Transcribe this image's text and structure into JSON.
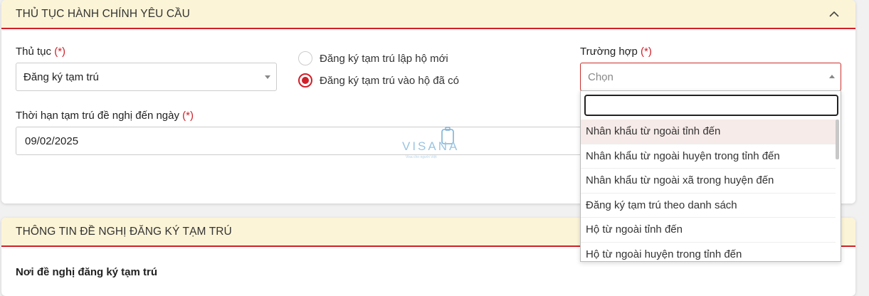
{
  "section1": {
    "title": "THỦ TỤC HÀNH CHÍNH YÊU CẦU"
  },
  "procedure": {
    "label": "Thủ tục",
    "required": "(*)",
    "value": "Đăng ký tạm trú"
  },
  "options": [
    {
      "label": "Đăng ký tạm trú lập hộ mới",
      "checked": false
    },
    {
      "label": "Đăng ký tạm trú vào hộ đã có",
      "checked": true
    }
  ],
  "case_field": {
    "label": "Trường hợp",
    "required": "(*)",
    "placeholder": "Chọn"
  },
  "duration": {
    "label": "Thời hạn tạm trú đề nghị đến ngày",
    "required": "(*)",
    "value": "09/02/2025"
  },
  "dropdown": {
    "search_value": "",
    "items": [
      "Nhân khẩu từ ngoài tỉnh đến",
      "Nhân khẩu từ ngoài huyện trong tỉnh đến",
      "Nhân khẩu từ ngoài xã trong huyện đến",
      "Đăng ký tạm trú theo danh sách",
      "Hộ từ ngoài tỉnh đến",
      "Hộ từ ngoài huyện trong tỉnh đến"
    ],
    "highlighted_index": 0
  },
  "watermark": {
    "brand": "VISANA",
    "tagline": "Visa cho người Việt"
  },
  "section2": {
    "title": "THÔNG TIN ĐỀ NGHỊ ĐĂNG KÝ TẠM TRÚ",
    "subheading": "Nơi đề nghị đăng ký tạm trú"
  },
  "colors": {
    "accent": "#d0202a",
    "header_bg": "#fcf4d7",
    "highlight_bg": "#f6ebe8"
  }
}
